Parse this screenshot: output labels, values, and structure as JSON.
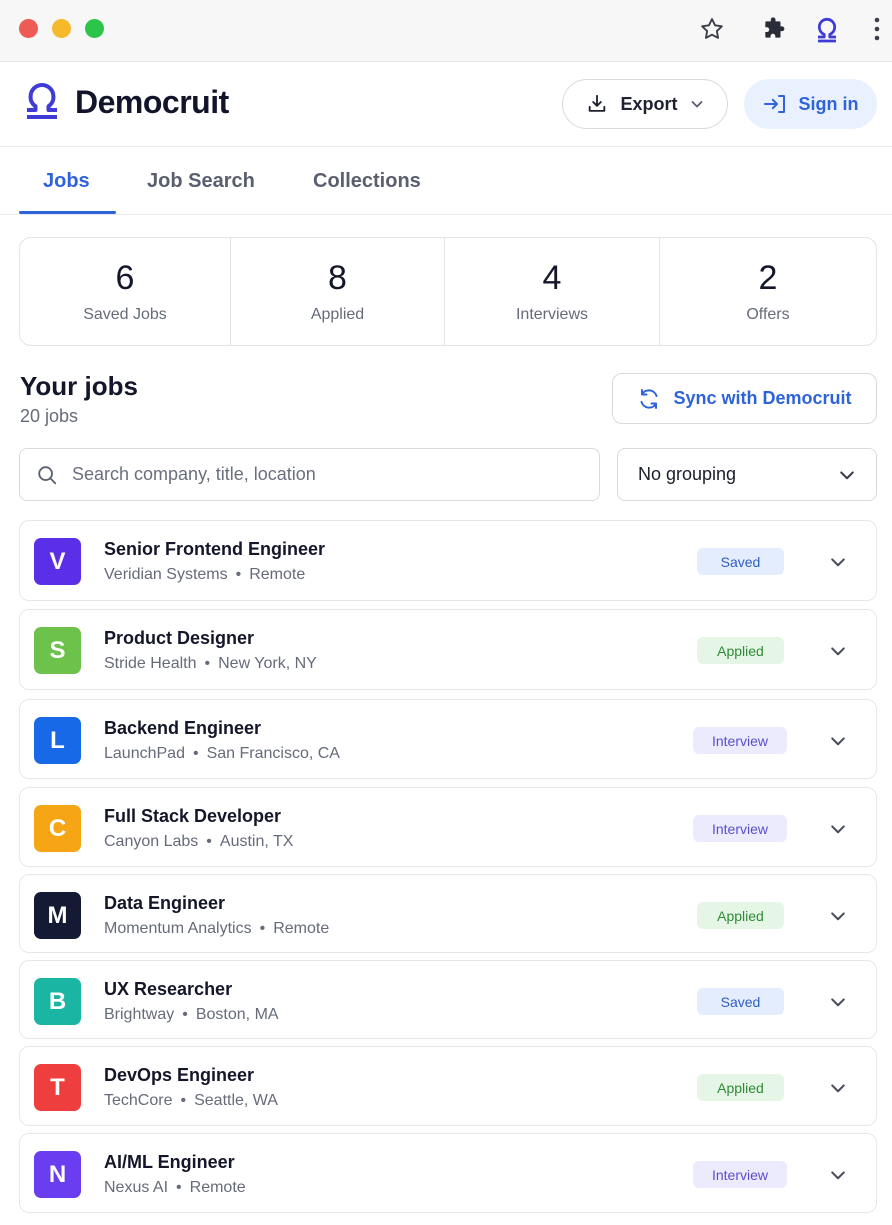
{
  "header": {
    "brand": "Democruit",
    "export_label": "Export",
    "signin_label": "Sign in"
  },
  "tabs": [
    {
      "label": "Jobs",
      "active": true
    },
    {
      "label": "Job Search",
      "active": false
    },
    {
      "label": "Collections",
      "active": false
    }
  ],
  "stats": [
    {
      "value": "6",
      "label": "Saved Jobs"
    },
    {
      "value": "8",
      "label": "Applied"
    },
    {
      "value": "4",
      "label": "Interviews"
    },
    {
      "value": "2",
      "label": "Offers"
    }
  ],
  "jobs_section": {
    "title": "Your jobs",
    "count": "20 jobs",
    "sync_label": "Sync with Democruit",
    "search_placeholder": "Search company, title, location",
    "grouping_value": "No grouping"
  },
  "colors": {
    "accent": "#2f63d9",
    "status_saved_bg": "#e4edfd",
    "status_saved_fg": "#2f5ebf",
    "status_applied_bg": "#e6f6e6",
    "status_applied_fg": "#2e8b35",
    "status_interview_bg": "#ecebfd",
    "status_interview_fg": "#5b4fc9"
  },
  "jobs": [
    {
      "initial": "V",
      "color": "#5b2ee8",
      "title": "Senior Frontend Engineer",
      "company": "Veridian Systems",
      "location": "Remote",
      "status": "Saved"
    },
    {
      "initial": "S",
      "color": "#6cc24a",
      "title": "Product Designer",
      "company": "Stride Health",
      "location": "New York, NY",
      "status": "Applied"
    },
    {
      "initial": "L",
      "color": "#1769e8",
      "title": "Backend Engineer",
      "company": "LaunchPad",
      "location": "San Francisco, CA",
      "status": "Interview"
    },
    {
      "initial": "C",
      "color": "#f6a614",
      "title": "Full Stack Developer",
      "company": "Canyon Labs",
      "location": "Austin, TX",
      "status": "Interview"
    },
    {
      "initial": "M",
      "color": "#141a33",
      "title": "Data Engineer",
      "company": "Momentum Analytics",
      "location": "Remote",
      "status": "Applied"
    },
    {
      "initial": "B",
      "color": "#1bb5a4",
      "title": "UX Researcher",
      "company": "Brightway",
      "location": "Boston, MA",
      "status": "Saved"
    },
    {
      "initial": "T",
      "color": "#ef3e3e",
      "title": "DevOps Engineer",
      "company": "TechCore",
      "location": "Seattle, WA",
      "status": "Applied"
    },
    {
      "initial": "N",
      "color": "#6a3ef0",
      "title": "AI/ML Engineer",
      "company": "Nexus AI",
      "location": "Remote",
      "status": "Interview"
    }
  ]
}
